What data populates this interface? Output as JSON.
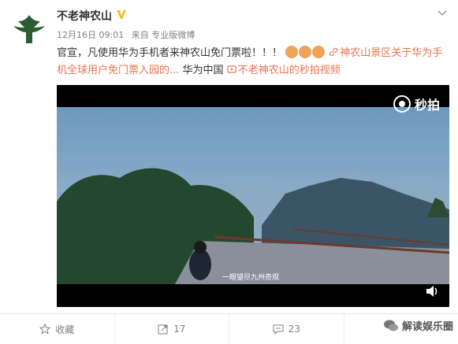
{
  "header": {
    "username": "不老神农山",
    "date": "12月16日 09:01",
    "source": "来自 专业版微博"
  },
  "post": {
    "text_main": "官宣，凡使用华为手机者来神农山免门票啦！！！",
    "link1_text": "神农山景区关于华为手机全球用户免门票入园的...",
    "text_after_link": "华为中国",
    "link2_text": "不老神农山的秒拍视频"
  },
  "video": {
    "brand": "秒拍",
    "subtitle": "一眼望尽九州奇观"
  },
  "actions": {
    "favorite_label": "收藏",
    "repost_count": "17",
    "comment_count": "23"
  },
  "watermark": {
    "text": "解读娱乐圈"
  },
  "colors": {
    "link": "#eb7350",
    "verified": "#ffbb1e",
    "avatar": "#2a5e32"
  }
}
